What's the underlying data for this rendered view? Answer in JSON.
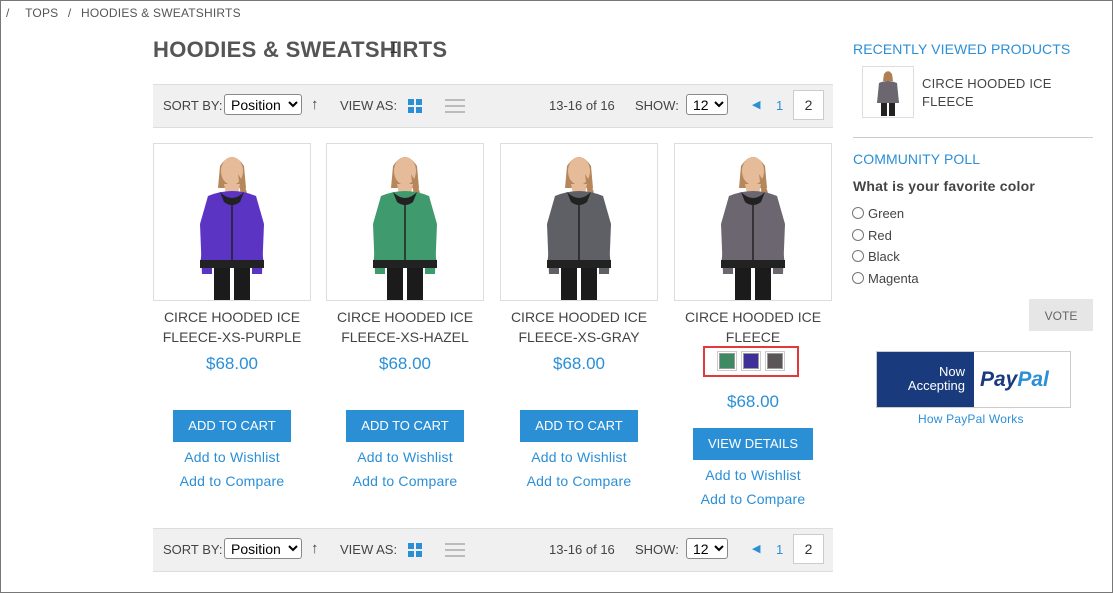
{
  "breadcrumb": {
    "sep": "/",
    "items": [
      "TOPS",
      "HOODIES & SWEATSHIRTS"
    ]
  },
  "page_title": "HOODIES & SWEATSHIRTS",
  "toolbar": {
    "sort_label": "SORT BY:",
    "sort_value": "Position",
    "sort_direction_icon": "arrow-up-icon",
    "view_label": "VIEW AS:",
    "count": "13-16 of 16",
    "show_label": "SHOW:",
    "show_value": "12",
    "pages": [
      "1",
      "2"
    ],
    "current_page": "2"
  },
  "products": [
    {
      "name": "CIRCE HOODED ICE FLEECE-XS-PURPLE",
      "price": "$68.00",
      "button": "ADD TO CART",
      "wishlist": "Add to Wishlist",
      "compare": "Add to Compare",
      "color": "#5b34c4"
    },
    {
      "name": "CIRCE HOODED ICE FLEECE-XS-HAZEL",
      "price": "$68.00",
      "button": "ADD TO CART",
      "wishlist": "Add to Wishlist",
      "compare": "Add to Compare",
      "color": "#3f9a6e"
    },
    {
      "name": "CIRCE HOODED ICE FLEECE-XS-GRAY",
      "price": "$68.00",
      "button": "ADD TO CART",
      "wishlist": "Add to Wishlist",
      "compare": "Add to Compare",
      "color": "#5f5f66"
    },
    {
      "name": "CIRCE HOODED ICE FLEECE",
      "price": "$68.00",
      "button": "VIEW DETAILS",
      "wishlist": "Add to Wishlist",
      "compare": "Add to Compare",
      "color": "#6b6670"
    }
  ],
  "swatches": [
    "#3f8a63",
    "#3f2f99",
    "#5b5558"
  ],
  "sidebar": {
    "recently_viewed_title": "RECENTLY VIEWED PRODUCTS",
    "recently_viewed_item": "CIRCE HOODED ICE FLEECE",
    "poll_title": "COMMUNITY POLL",
    "poll_question": "What is your favorite color",
    "poll_options": [
      "Green",
      "Red",
      "Black",
      "Magenta"
    ],
    "vote_label": "VOTE",
    "paypal_now": "Now",
    "paypal_accepting": "Accepting",
    "paypal_logo": "PayPal",
    "paypal_link": "How PayPal Works"
  },
  "colors": {
    "accent": "#2b8fd6",
    "paypal_blue": "#1a3a7e",
    "highlight": "#e03a3a"
  }
}
